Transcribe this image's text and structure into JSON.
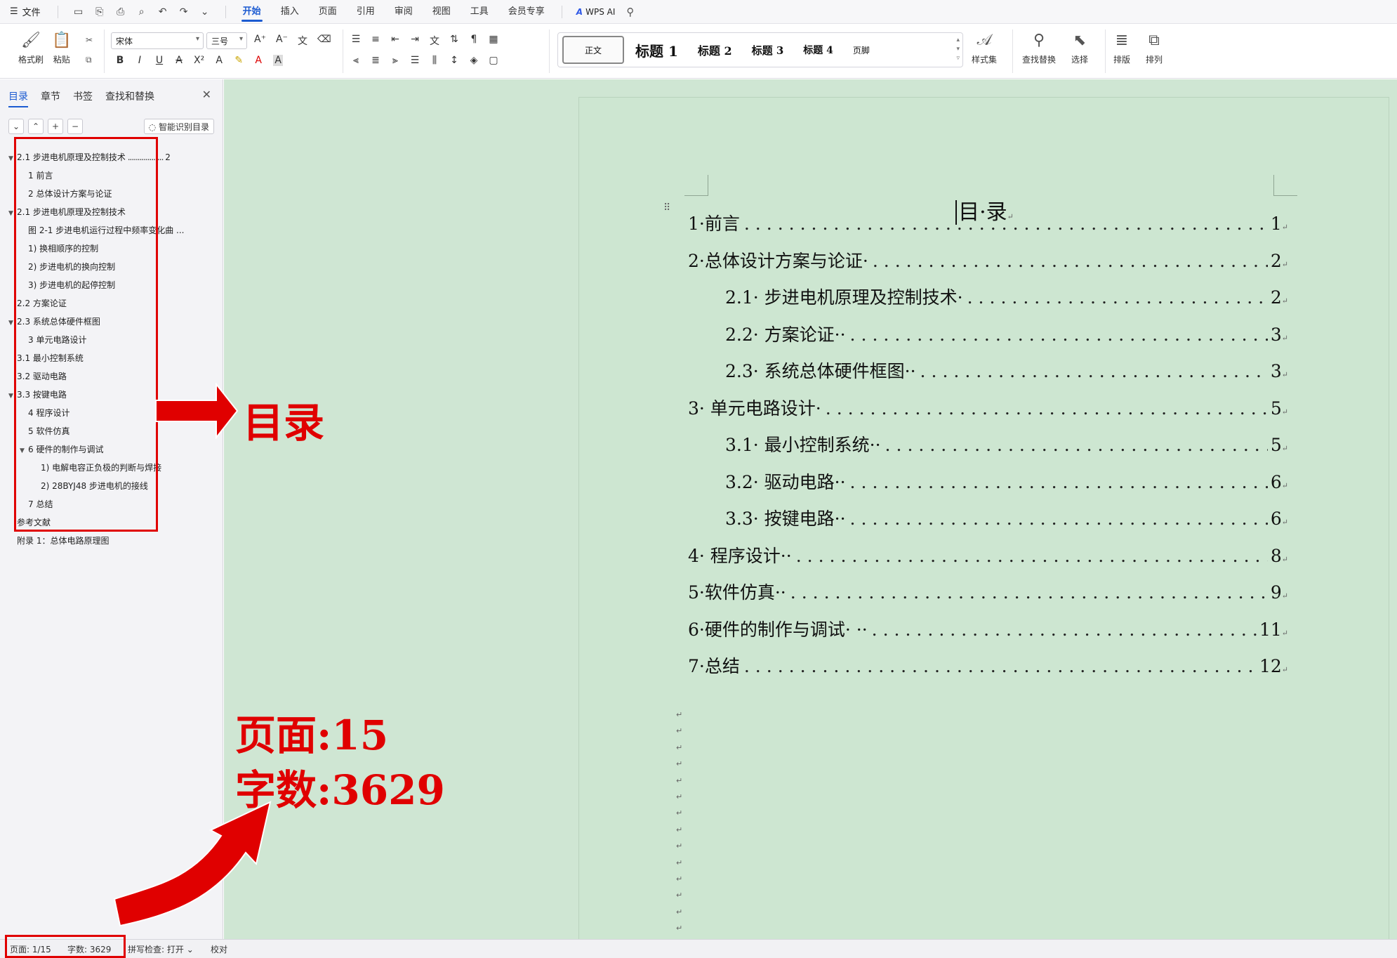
{
  "menubar": {
    "file_label": "文件",
    "tabs": [
      "开始",
      "插入",
      "页面",
      "引用",
      "审阅",
      "视图",
      "工具",
      "会员专享"
    ],
    "active_tab": "开始",
    "ai_label": "WPS AI"
  },
  "ribbon": {
    "format_painter": "格式刷",
    "paste": "粘贴",
    "font_name": "宋体",
    "font_size": "三号",
    "styles": [
      "正文",
      "标题 1",
      "标题 2",
      "标题 3",
      "标题 4",
      "页脚"
    ],
    "style_set": "样式集",
    "find_replace": "查找替换",
    "select": "选择",
    "layout": "排版",
    "arrange": "排列"
  },
  "sidebar": {
    "tabs": [
      "目录",
      "章节",
      "书签",
      "查找和替换"
    ],
    "smart_toc": "智能识别目录",
    "items": [
      {
        "label": "2.1  步进电机原理及控制技术",
        "page": "2",
        "level": 0,
        "caret": "▼"
      },
      {
        "label": "1  前言",
        "page": "",
        "level": 1,
        "caret": ""
      },
      {
        "label": "2   总体设计方案与论证",
        "page": "",
        "level": 1,
        "caret": ""
      },
      {
        "label": "2.1  步进电机原理及控制技术",
        "page": "",
        "level": 0,
        "caret": "▼"
      },
      {
        "label": "图  2-1       步进电机运行过程中频率变化曲 ...",
        "page": "",
        "level": 1,
        "caret": ""
      },
      {
        "label": "1)    换相顺序的控制",
        "page": "",
        "level": 1,
        "caret": ""
      },
      {
        "label": "2)    步进电机的换向控制",
        "page": "",
        "level": 1,
        "caret": ""
      },
      {
        "label": "3)  步进电机的起停控制",
        "page": "",
        "level": 1,
        "caret": ""
      },
      {
        "label": "2.2    方案论证",
        "page": "",
        "level": 0,
        "caret": ""
      },
      {
        "label": "2.3  系统总体硬件框图",
        "page": "",
        "level": 0,
        "caret": "▼"
      },
      {
        "label": "3    单元电路设计",
        "page": "",
        "level": 1,
        "caret": ""
      },
      {
        "label": "3.1  最小控制系统",
        "page": "",
        "level": 0,
        "caret": ""
      },
      {
        "label": "3.2    驱动电路",
        "page": "",
        "level": 0,
        "caret": ""
      },
      {
        "label": "3.3  按键电路",
        "page": "",
        "level": 0,
        "caret": "▼"
      },
      {
        "label": "4  程序设计",
        "page": "",
        "level": 1,
        "caret": ""
      },
      {
        "label": "5   软件仿真",
        "page": "",
        "level": 1,
        "caret": ""
      },
      {
        "label": "6  硬件的制作与调试",
        "page": "",
        "level": 1,
        "caret": "▼"
      },
      {
        "label": "1)     电解电容正负极的判断与焊接",
        "page": "",
        "level": 2,
        "caret": ""
      },
      {
        "label": "2)     28BYJ48  步进电机的接线",
        "page": "",
        "level": 2,
        "caret": ""
      },
      {
        "label": "7  总结",
        "page": "",
        "level": 1,
        "caret": ""
      },
      {
        "label": "参考文献",
        "page": "",
        "level": 0,
        "caret": ""
      },
      {
        "label": "附录    1：总体电路原理图",
        "page": "",
        "level": 0,
        "caret": ""
      }
    ]
  },
  "document": {
    "title": "目·录",
    "toc": [
      {
        "text": "1·前言",
        "page": "1",
        "indent": 0
      },
      {
        "text": "2·总体设计方案与论证·",
        "page": "2",
        "indent": 0
      },
      {
        "text": "2.1· 步进电机原理及控制技术·",
        "page": "2",
        "indent": 1
      },
      {
        "text": "2.2· 方案论证··",
        "page": "3",
        "indent": 1
      },
      {
        "text": "2.3· 系统总体硬件框图··",
        "page": "3",
        "indent": 1
      },
      {
        "text": "3· 单元电路设计·",
        "page": "5",
        "indent": 0
      },
      {
        "text": "3.1· 最小控制系统··",
        "page": "5",
        "indent": 1
      },
      {
        "text": "3.2· 驱动电路··",
        "page": "6",
        "indent": 1
      },
      {
        "text": "3.3· 按键电路··",
        "page": "6",
        "indent": 1
      },
      {
        "text": "4· 程序设计··",
        "page": "8",
        "indent": 0
      },
      {
        "text": "5·软件仿真··",
        "page": "9",
        "indent": 0
      },
      {
        "text": "6·硬件的制作与调试· ··",
        "page": "11",
        "indent": 0
      },
      {
        "text": "7·总结",
        "page": "12",
        "indent": 0
      }
    ]
  },
  "statusbar": {
    "page": "页面: 1/15",
    "words": "字数: 3629",
    "spellcheck": "拼写检查: 打开",
    "proofread": "校对"
  },
  "annotations": {
    "toc_label": "目录",
    "page_count": "页面:15",
    "word_count": "字数:3629",
    "color": "#e00000"
  }
}
